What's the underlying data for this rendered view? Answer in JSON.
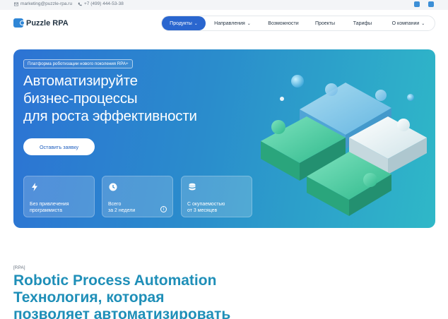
{
  "topbar": {
    "email": "marketing@puzzle-rpa.ru",
    "phone": "+7 (499) 444-53-38",
    "social": [
      "vk-icon",
      "telegram-icon"
    ]
  },
  "header": {
    "logo_text": "Puzzle RPA",
    "nav": [
      {
        "label": "Продукты",
        "dropdown": true,
        "active": true
      },
      {
        "label": "Направления",
        "dropdown": true,
        "active": false
      },
      {
        "label": "Возможности",
        "dropdown": false,
        "active": false
      },
      {
        "label": "Проекты",
        "dropdown": false,
        "active": false
      },
      {
        "label": "Тарифы",
        "dropdown": false,
        "active": false
      },
      {
        "label": "О компании",
        "dropdown": true,
        "active": false
      }
    ]
  },
  "hero": {
    "badge": "Платформа роботизации нового поколения RPA+",
    "title_lines": [
      "Автоматизируйте",
      "бизнес-процессы",
      "для роста эффективности"
    ],
    "cta_label": "Оставить заявку",
    "cards": [
      {
        "icon": "lightning-icon",
        "lines": [
          "Без привлечения",
          "программиста"
        ],
        "info": false
      },
      {
        "icon": "clock-icon",
        "lines": [
          "Всего",
          "за 2 недели"
        ],
        "info": true
      },
      {
        "icon": "database-icon",
        "lines": [
          "С окупаемостью",
          "от 3 месяцев"
        ],
        "info": false
      }
    ],
    "colors": {
      "gradient_start": "#2c73d4",
      "gradient_end": "#2fb8c8"
    }
  },
  "rpa_section": {
    "tag": "[RPA]",
    "title_lines": [
      "Robotic Process Automation",
      "Технология, которая",
      "позволяет автоматизировать"
    ]
  }
}
